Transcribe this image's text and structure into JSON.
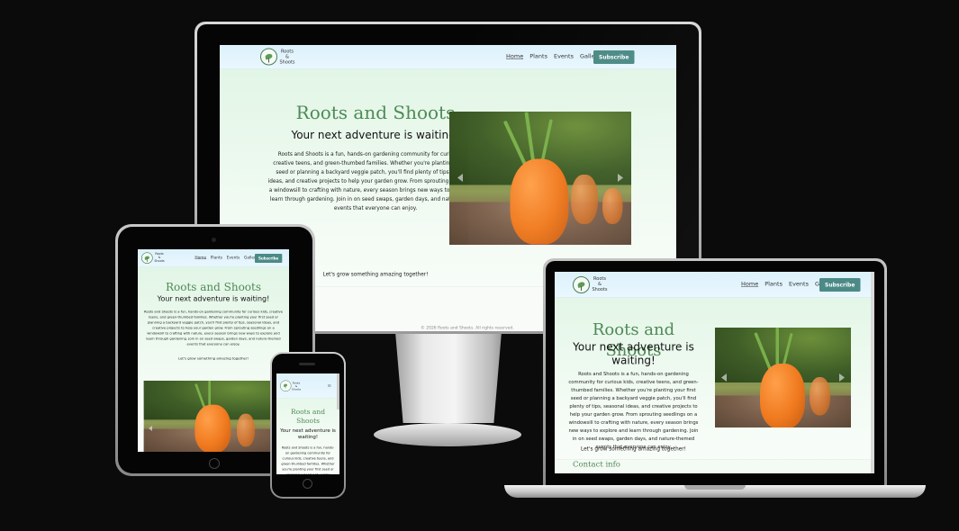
{
  "site": {
    "brand_line1": "Roots",
    "brand_line2": "&",
    "brand_line3": "Shoots",
    "nav": [
      "Home",
      "Plants",
      "Events",
      "Gallery"
    ],
    "subscribe": "Subscribe",
    "hero_title": "Roots and Shoots",
    "hero_subtitle": "Your next adventure is waiting!",
    "hero_text": "Roots and Shoots is a fun, hands-on gardening community for curious kids, creative teens, and green-thumbed families. Whether you're planting your first seed or planning a backyard veggie patch, you'll find plenty of tips, seasonal ideas, and creative projects to help your garden grow. From sprouting seedlings on a windowsill to crafting with nature, every season brings new ways to explore and learn through gardening. Join in on seed swaps, garden days, and nature-themed events that everyone can enjoy.",
    "hero_tagline": "Let's grow something amazing together!",
    "contact_heading": "Contact info",
    "footer": "© 2026 Roots and Shoots. All rights reserved.",
    "footer_partial": "om"
  },
  "colors": {
    "accent_green": "#4f8a56",
    "subscribe_teal": "#4b8a86",
    "background": "#0b0b0b"
  }
}
